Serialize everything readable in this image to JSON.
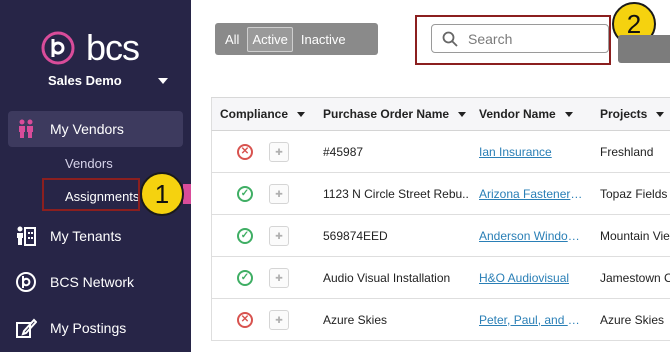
{
  "app": {
    "logo_text": "bcs",
    "org_name": "Sales Demo"
  },
  "sidebar": {
    "items": [
      {
        "label": "My Vendors",
        "icon": "people-icon"
      },
      {
        "label": "My Tenants",
        "icon": "tenants-icon"
      },
      {
        "label": "BCS Network",
        "icon": "bcs-network-icon"
      },
      {
        "label": "My Postings",
        "icon": "postings-icon"
      }
    ],
    "sub_items": [
      {
        "label": "Vendors"
      },
      {
        "label": "Assignments"
      }
    ]
  },
  "filter": {
    "options": [
      "All",
      "Active",
      "Inactive"
    ],
    "selected": "Active"
  },
  "search": {
    "placeholder": "Search"
  },
  "callouts": [
    "1",
    "2"
  ],
  "table": {
    "columns": [
      "Compliance",
      "Purchase Order Name",
      "Vendor Name",
      "Projects"
    ],
    "rows": [
      {
        "compliance": "bad",
        "po": "#45987",
        "vendor": "Ian Insurance",
        "project": "Freshland"
      },
      {
        "compliance": "ok",
        "po": "1123 N Circle Street Rebu...",
        "vendor": "Arizona Fasteners ...",
        "project": "Topaz Fields"
      },
      {
        "compliance": "ok",
        "po": "569874EED",
        "vendor": "Anderson Window...",
        "project": "Mountain View"
      },
      {
        "compliance": "ok",
        "po": "Audio Visual Installation",
        "vendor": "H&O Audiovisual",
        "project": "Jamestown C"
      },
      {
        "compliance": "bad",
        "po": "Azure Skies",
        "vendor": "Peter, Paul, and Sh...",
        "project": "Azure Skies"
      }
    ]
  },
  "colors": {
    "sidebar_bg": "#272547",
    "accent_pink": "#d94c9a",
    "callout_yellow": "#f5d20f",
    "link": "#2a7fb6",
    "ok": "#3fae64",
    "bad": "#d8534f"
  }
}
